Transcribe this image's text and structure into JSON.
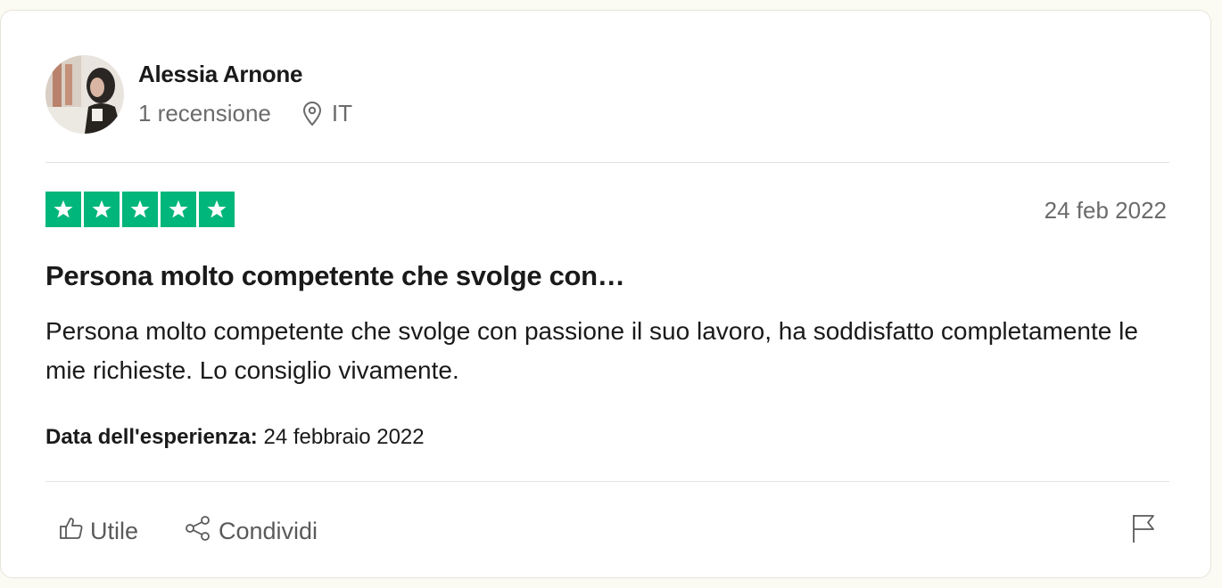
{
  "reviewer": {
    "name": "Alessia Arnone",
    "review_count": "1 recensione",
    "country": "IT",
    "avatar_icon": "user-avatar-photo"
  },
  "review": {
    "rating": 5,
    "rating_max": 5,
    "star_color": "#00b67a",
    "date": "24 feb 2022",
    "title": "Persona molto competente che svolge con…",
    "body": "Persona molto competente che svolge con passione il suo lavoro, ha soddisfatto completamente le mie richieste. Lo consiglio vivamente.",
    "experience_label": "Data dell'esperienza:",
    "experience_date": "24 febbraio 2022"
  },
  "actions": {
    "useful_label": "Utile",
    "useful_icon": "thumbs-up-icon",
    "share_label": "Condividi",
    "share_icon": "share-icon",
    "report_icon": "flag-icon"
  }
}
